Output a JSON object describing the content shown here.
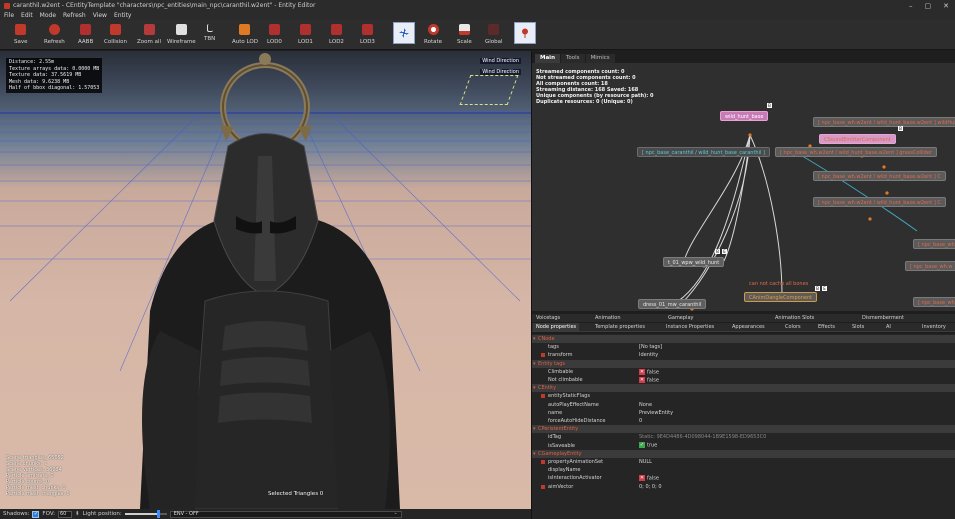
{
  "window": {
    "title": "caranthil.w2ent - CEntityTemplate \"characters\\npc_entities\\main_npc\\caranthil.w2ent\" - Entity Editor",
    "controls": [
      "–",
      "▢",
      "✕"
    ]
  },
  "menu": [
    "File",
    "Edit",
    "Mode",
    "Refresh",
    "View",
    "Entity"
  ],
  "toolbar": {
    "buttons": [
      "Save",
      "Refresh",
      "AABB",
      "Collision",
      "Zoom all",
      "Wireframe",
      "TBN",
      "Auto LOD",
      "LOD0",
      "LOD1",
      "LOD2",
      "LOD3",
      "Rotate",
      "Scale",
      "Global"
    ]
  },
  "viewport": {
    "stats": [
      "Distance: 2.55m",
      "Texture arrays data: 0.0000 MB",
      "Texture data: 37.5619 MB",
      "Mesh data: 9.6238 MB",
      "Half of bbox diagonal: 1.57053"
    ],
    "wind_labels": [
      "Wind Direction",
      "Wind Direction"
    ],
    "bottom_stats": [
      "Scene triangles: 65652",
      "Scene chunks: 7",
      "Scene vertices: 36034",
      "",
      "Particle emitters: 0",
      "Particle counts: 0",
      "Particle mesh chunks: 0",
      "Particle mesh triangles: 0"
    ],
    "selected_triangles": "Selected Triangles 0"
  },
  "viewport_footer": {
    "shadows_label": "Shadows:",
    "fov_label": "FOV:",
    "fov_value": "60",
    "light_label": "Light position:",
    "light_position": 0.8,
    "env_value": "ENV - OFF"
  },
  "graph": {
    "tabs": [
      "Main",
      "Tools",
      "Mimics"
    ],
    "info": [
      "Streamed components count: 0",
      "Not streamed components count: 0",
      "All components count: 18",
      "Streaming distance: 168 Saved: 168",
      "Unique components (by resource path): 0",
      "Duplicate resources: 0 (Unique: 0)"
    ],
    "nodes": {
      "wild_hunt_base": "wild_hunt_base",
      "cliche_component": "CSoundEmitterComponent",
      "teal_node": "[ npc_base_caranthil / wild_hunt_base_caranthil ]",
      "grey_link_1": "[ npc_base_wh.w2ent / wild_hunt_base.w2ent ] wildHunt...",
      "grey_link_2": "[ npc_base_wh.w2ent / wild_hunt_base.w2ent ] grassCollider",
      "grey_link_3": "[ npc_base_wh.w2ent / wild_hunt_base.w2ent ] C",
      "grey_link_4": "[ npc_base_wh.w2ent / wild_hunt_base.w2ent ] C",
      "grey_link_5": "[ npc_base_wh.w2ent / wild_hunt_base.w2ent ] C",
      "right_stub_1": "[ npc_base_wh",
      "right_stub_2": "[ npc_base_wh.w",
      "right_stub_3": "[ npc_base_wh",
      "t_01_wild_hunt": "t_01_wpw_wild_hunt",
      "dress_01": "dress_01_mw_caranthil",
      "anim_tangle": "CAnimDangleComponent",
      "cache_note": "can not cache all bones"
    }
  },
  "property_tabs": {
    "row1": [
      "Voicetags",
      "Animation",
      "Gameplay",
      "Animation Slots",
      "Dismemberment"
    ],
    "row2": [
      "Node properties",
      "Template properties",
      "Instance Properties",
      "Appearances",
      "Colors",
      "Effects",
      "Slots",
      "AI",
      "Inventory"
    ]
  },
  "properties": [
    {
      "type": "cat",
      "name": "CNode",
      "value": ""
    },
    {
      "type": "prop",
      "name": "tags",
      "value": "[No tags]"
    },
    {
      "type": "prop",
      "name": "transform",
      "value": "Identity",
      "marker": true
    },
    {
      "type": "cat",
      "name": "Entity tags",
      "value": ""
    },
    {
      "type": "prop",
      "name": "Climbable",
      "value": "false",
      "icon": "x"
    },
    {
      "type": "prop",
      "name": "Not climbable",
      "value": "false",
      "icon": "x"
    },
    {
      "type": "cat",
      "name": "CEntity",
      "value": ""
    },
    {
      "type": "prop",
      "name": "entityStaticFlags",
      "value": "",
      "marker": true
    },
    {
      "type": "prop",
      "name": "autoPlayEffectName",
      "value": "None"
    },
    {
      "type": "prop",
      "name": "name",
      "value": "PreviewEntity"
    },
    {
      "type": "prop",
      "name": "forceAutoHideDistance",
      "value": "0"
    },
    {
      "type": "cat",
      "name": "CPeristentEntity",
      "value": ""
    },
    {
      "type": "prop",
      "name": "idTag",
      "value": "Static: 9E4D4486-4D098044-1B9E1598-ED9653C0",
      "dim": true
    },
    {
      "type": "prop",
      "name": "isSaveable",
      "value": "true",
      "icon": "ok"
    },
    {
      "type": "cat",
      "name": "CGameplayEntity",
      "value": ""
    },
    {
      "type": "prop",
      "name": "propertyAnimationSet",
      "value": "NULL",
      "marker": true
    },
    {
      "type": "prop",
      "name": "displayName",
      "value": ""
    },
    {
      "type": "prop",
      "name": "isInteractionActivator",
      "value": "false",
      "icon": "x"
    },
    {
      "type": "prop",
      "name": "aimVector",
      "value": "0; 0; 0; 0",
      "marker": true
    }
  ],
  "colors": {
    "accent_blue": "#2f7fd8",
    "category_red": "#e06045",
    "node_pink": "#c87ab4"
  }
}
